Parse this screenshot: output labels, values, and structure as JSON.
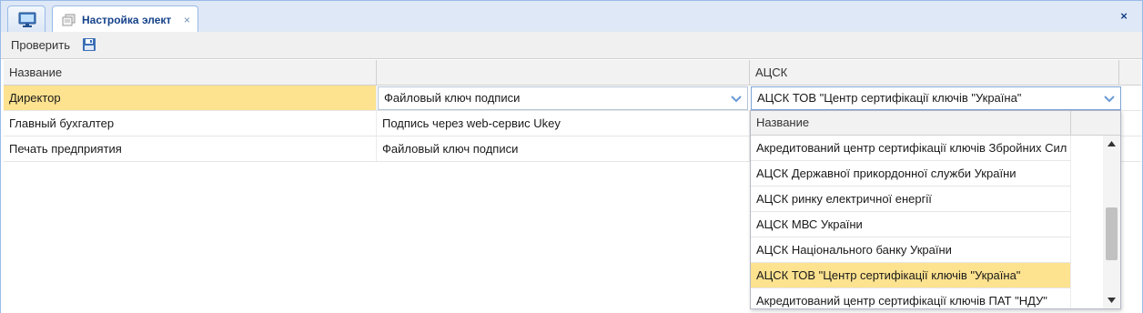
{
  "tabs": {
    "active_title": "Настройка элект",
    "close_glyph": "×",
    "window_close_glyph": "×"
  },
  "toolbar": {
    "check_label": "Проверить",
    "save_icon": "floppy-disk-icon"
  },
  "grid": {
    "columns": [
      "Название",
      "",
      "АЦСК",
      ""
    ],
    "rows": [
      {
        "name": "Директор",
        "key_type": "Файловый ключ подписи",
        "acsk": "АЦСК ТОВ \"Центр сертифікації ключів \"Україна\""
      },
      {
        "name": "Главный бухгалтер",
        "key_type": "Подпись через web-сервис Ukey",
        "acsk": ""
      },
      {
        "name": "Печать предприятия",
        "key_type": "Файловый ключ подписи",
        "acsk": ""
      }
    ],
    "selected_row": 0
  },
  "dropdown": {
    "header": "Название",
    "items": [
      "Акредитований центр сертифікації ключів Збройних Сил",
      "АЦСК Державної прикордонної служби України",
      "АЦСК ринку електричної енергії",
      "АЦСК МВС України",
      "АЦСК Національного банку України",
      "АЦСК ТОВ \"Центр сертифікації ключів \"Україна\"",
      "Акредитований центр сертифікації ключів ПАТ \"НДУ\""
    ],
    "selected_index": 5
  },
  "colors": {
    "selection": "#fde28f",
    "frame": "#99bbe8",
    "title_text": "#15428b"
  }
}
